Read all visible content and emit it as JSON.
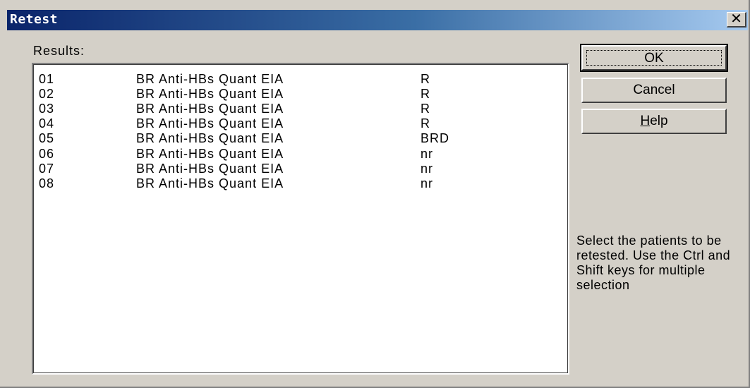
{
  "window": {
    "title": "Retest",
    "close_label": "✕"
  },
  "results": {
    "label": "Results:",
    "rows": [
      {
        "id": "01",
        "test": "BR Anti-HBs Quant EIA",
        "result": "R"
      },
      {
        "id": "02",
        "test": "BR Anti-HBs Quant EIA",
        "result": "R"
      },
      {
        "id": "03",
        "test": "BR Anti-HBs Quant EIA",
        "result": "R"
      },
      {
        "id": "04",
        "test": "BR Anti-HBs Quant EIA",
        "result": "R"
      },
      {
        "id": "05",
        "test": "BR Anti-HBs Quant EIA",
        "result": "BRD"
      },
      {
        "id": "06",
        "test": "BR Anti-HBs Quant EIA",
        "result": "nr"
      },
      {
        "id": "07",
        "test": "BR Anti-HBs Quant EIA",
        "result": "nr"
      },
      {
        "id": "08",
        "test": "BR Anti-HBs Quant EIA",
        "result": "nr"
      }
    ]
  },
  "buttons": {
    "ok": "OK",
    "cancel": "Cancel",
    "help_mnemonic": "H",
    "help_rest": "elp"
  },
  "instructions": "Select the patients to be retested. Use the Ctrl and Shift keys for multiple selection",
  "colors": {
    "title_start": "#0a246a",
    "title_end": "#a6caf0",
    "face": "#d4d0c8"
  }
}
